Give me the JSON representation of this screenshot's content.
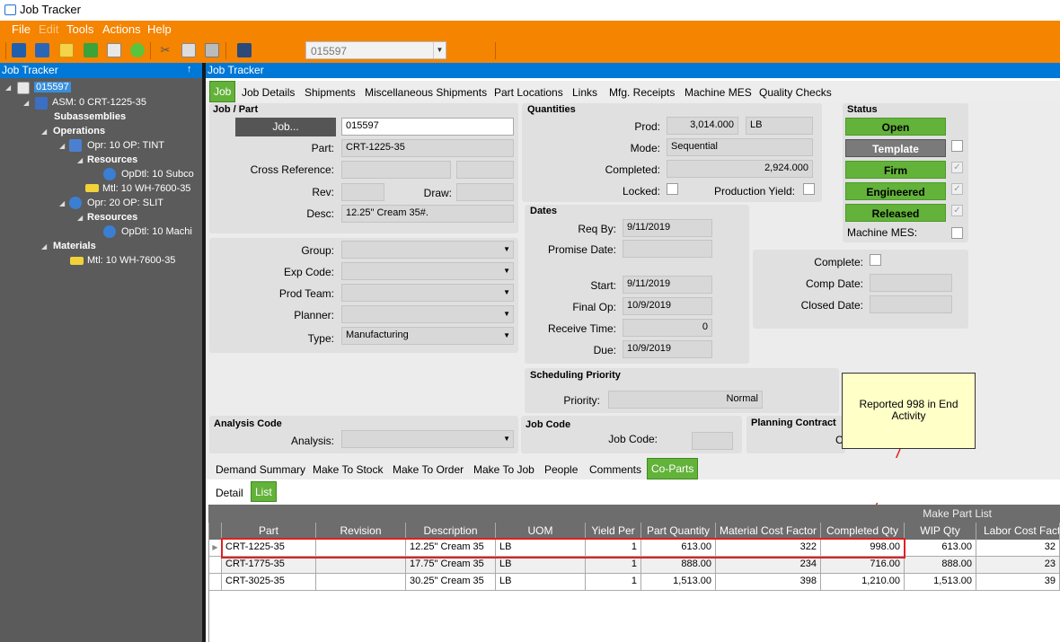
{
  "window": {
    "title": "Job Tracker"
  },
  "menu": [
    "File",
    "Edit",
    "Tools",
    "Actions",
    "Help"
  ],
  "toolbar": {
    "job_combo_value": "015597"
  },
  "left_panel": {
    "header": "Job Tracker",
    "pin": "↑",
    "tree": {
      "root": "015597",
      "asm": "ASM: 0 CRT-1225-35",
      "subassemblies": "Subassemblies",
      "operations": "Operations",
      "op10": "Opr: 10 OP: TINT",
      "op10_resources": "Resources",
      "op10_opdtl": "OpDtl: 10 Subco",
      "op10_mtl": "Mtl: 10 WH-7600-35",
      "op20": "Opr: 20 OP: SLIT",
      "op20_resources": "Resources",
      "op20_opdtl": "OpDtl: 10 Machi",
      "materials": "Materials",
      "mat_mtl": "Mtl: 10 WH-7600-35"
    }
  },
  "right_panel": {
    "header": "Job Tracker"
  },
  "tabs": [
    "Job",
    "Job Details",
    "Shipments",
    "Miscellaneous Shipments",
    "Part Locations",
    "Links",
    "Mfg. Receipts",
    "Machine MES",
    "Quality Checks"
  ],
  "job_part": {
    "section": "Job / Part",
    "job_button": "Job...",
    "job_value": "015597",
    "part_label": "Part:",
    "part_value": "CRT-1225-35",
    "cross_ref_label": "Cross Reference:",
    "rev_label": "Rev:",
    "draw_label": "Draw:",
    "desc_label": "Desc:",
    "desc_value": "12.25\" Cream 35#."
  },
  "misc_fields": {
    "group_label": "Group:",
    "exp_code_label": "Exp Code:",
    "prod_team_label": "Prod Team:",
    "planner_label": "Planner:",
    "type_label": "Type:",
    "type_value": "Manufacturing"
  },
  "quantities": {
    "section": "Quantities",
    "prod_label": "Prod:",
    "prod_value": "3,014.000",
    "prod_uom": "LB",
    "mode_label": "Mode:",
    "mode_value": "Sequential",
    "completed_label": "Completed:",
    "completed_value": "2,924.000",
    "locked_label": "Locked:",
    "prod_yield_label": "Production Yield:"
  },
  "dates": {
    "section": "Dates",
    "req_by_label": "Req By:",
    "req_by_value": "9/11/2019",
    "promise_label": "Promise Date:",
    "start_label": "Start:",
    "start_value": "9/11/2019",
    "final_op_label": "Final Op:",
    "final_op_value": "10/9/2019",
    "receive_label": "Receive Time:",
    "receive_value": "0",
    "due_label": "Due:",
    "due_value": "10/9/2019"
  },
  "status": {
    "section": "Status",
    "open": "Open",
    "template": "Template",
    "firm": "Firm",
    "engineered": "Engineered",
    "released": "Released",
    "machine_mes_label": "Machine MES:"
  },
  "completion": {
    "complete_label": "Complete:",
    "comp_date_label": "Comp Date:",
    "closed_date_label": "Closed Date:"
  },
  "scheduling": {
    "section": "Scheduling Priority",
    "priority_label": "Priority:",
    "priority_value": "Normal"
  },
  "analysis": {
    "section": "Analysis Code",
    "label": "Analysis:"
  },
  "job_code": {
    "section": "Job Code",
    "label": "Job Code:"
  },
  "planning": {
    "section": "Planning Contract",
    "partial": "C"
  },
  "callout": "Reported 998 in End Activity",
  "bottom_tabs": [
    "Demand Summary",
    "Make To Stock",
    "Make To Order",
    "Make To Job",
    "People",
    "Comments",
    "Co-Parts"
  ],
  "list_tabs": [
    "Detail",
    "List"
  ],
  "grid": {
    "title": "Make Part List",
    "columns": [
      "Part",
      "Revision",
      "Description",
      "UOM",
      "Yield Per",
      "Part Quantity",
      "Material Cost Factor",
      "Completed Qty",
      "WIP Qty",
      "Labor Cost Facto"
    ],
    "rows": [
      [
        "CRT-1225-35",
        "",
        "12.25\" Cream 35",
        "LB",
        "1",
        "613.00",
        "322",
        "998.00",
        "613.00",
        "32"
      ],
      [
        "CRT-1775-35",
        "",
        "17.75\" Cream 35",
        "LB",
        "1",
        "888.00",
        "234",
        "716.00",
        "888.00",
        "23"
      ],
      [
        "CRT-3025-35",
        "",
        "30.25\" Cream 35",
        "LB",
        "1",
        "1,513.00",
        "398",
        "1,210.00",
        "1,513.00",
        "39"
      ]
    ]
  }
}
